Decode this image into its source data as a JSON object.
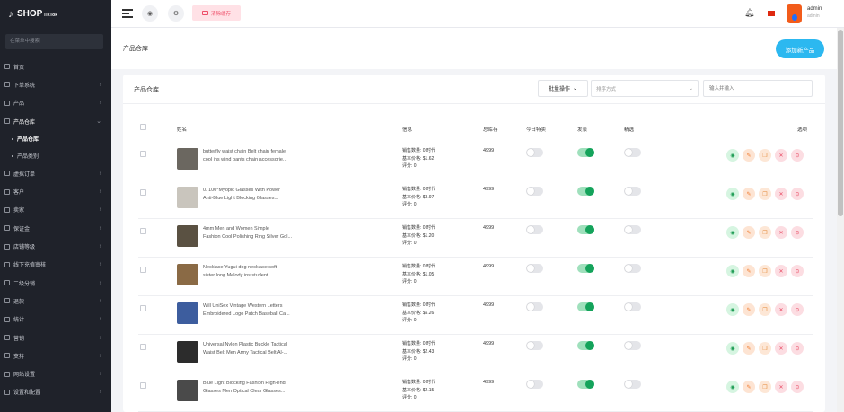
{
  "sidebar": {
    "logo_main": "SHOP",
    "logo_sub": "TikTok",
    "search_placeholder": "在菜单中搜索",
    "items": [
      {
        "label": "首页",
        "chev": ""
      },
      {
        "label": "下单系统",
        "chev": "›"
      },
      {
        "label": "产品",
        "chev": "›"
      },
      {
        "label": "产品仓库",
        "chev": "⌄",
        "active": true
      },
      {
        "label": "产品仓库",
        "sub": true,
        "current": true
      },
      {
        "label": "产品类别",
        "sub": true
      },
      {
        "label": "虚拟订单",
        "chev": "›"
      },
      {
        "label": "客户",
        "chev": "›"
      },
      {
        "label": "卖家",
        "chev": "›"
      },
      {
        "label": "保证金",
        "chev": "›"
      },
      {
        "label": "店铺等级",
        "chev": "›"
      },
      {
        "label": "线下充值审核",
        "chev": "›"
      },
      {
        "label": "二级分销",
        "chev": "›"
      },
      {
        "label": "退款",
        "chev": "›"
      },
      {
        "label": "统计",
        "chev": "›"
      },
      {
        "label": "营销",
        "chev": "›"
      },
      {
        "label": "支持",
        "chev": "›"
      },
      {
        "label": "网站设置",
        "chev": "›"
      },
      {
        "label": "设置和配置",
        "chev": "›"
      }
    ]
  },
  "topbar": {
    "clear_cache": "清除缓存",
    "user_name": "admin",
    "user_role": "admin"
  },
  "page": {
    "title": "产品仓库",
    "add_button": "添加新产品"
  },
  "card": {
    "title": "产品仓库",
    "bulk_action": "批量操作",
    "sort_placeholder": "排序方式",
    "search_placeholder": "输入并输入"
  },
  "table": {
    "headers": {
      "name": "姓名",
      "info": "信息",
      "stock": "总库存",
      "today_deal": "今日特卖",
      "published": "发表",
      "featured": "精选",
      "options": "选项"
    },
    "rows": [
      {
        "name": [
          "butterfly waist chain Belt chain female",
          "cool ins wind pants chain accessorie..."
        ],
        "info": [
          "销售数量: 0 时代",
          "基本价格: $1.62",
          "评分: 0"
        ],
        "stock": "4999",
        "today_deal": false,
        "published": true,
        "featured": false
      },
      {
        "name": [
          "0. 100°Myopic Glasses With Power",
          "Anti-Blue Light Blocking Glasses..."
        ],
        "info": [
          "销售数量: 0 时代",
          "基本价格: $3.97",
          "评分: 0"
        ],
        "stock": "4999",
        "today_deal": false,
        "published": true,
        "featured": false
      },
      {
        "name": [
          "4mm Men and Women Simple",
          "Fashion Cool Polishing Ring Silver Gol..."
        ],
        "info": [
          "销售数量: 0 时代",
          "基本价格: $1.20",
          "评分: 0"
        ],
        "stock": "4999",
        "today_deal": false,
        "published": true,
        "featured": false
      },
      {
        "name": [
          "Necklace Yugui dog necklace soft",
          "sister long Melody ins student..."
        ],
        "info": [
          "销售数量: 0 时代",
          "基本价格: $1.05",
          "评分: 0"
        ],
        "stock": "4999",
        "today_deal": false,
        "published": true,
        "featured": false
      },
      {
        "name": [
          "Will UniSex Vintage Western Letters",
          "Embroidered Logo Patch Baseball Ca..."
        ],
        "info": [
          "销售数量: 0 时代",
          "基本价格: $5.26",
          "评分: 0"
        ],
        "stock": "4999",
        "today_deal": false,
        "published": true,
        "featured": false
      },
      {
        "name": [
          "Universal Nylon Plastic Buckle Tactical",
          "Waist Belt Men Army Tactical Belt Al-..."
        ],
        "info": [
          "销售数量: 0 时代",
          "基本价格: $2.43",
          "评分: 0"
        ],
        "stock": "4999",
        "today_deal": false,
        "published": true,
        "featured": false
      },
      {
        "name": [
          "Blue Light Blocking Fashion High-end",
          "Glasses Men Optical Clear Glasses..."
        ],
        "info": [
          "销售数量: 0 时代",
          "基本价格: $2.15",
          "评分: 0"
        ],
        "stock": "4999",
        "today_deal": false,
        "published": true,
        "featured": false
      }
    ]
  },
  "colors": {
    "sidebar_bg": "#1f222a",
    "accent": "#2cb8f0",
    "toggle_on": "#14a35b",
    "danger": "#ee4d68"
  }
}
